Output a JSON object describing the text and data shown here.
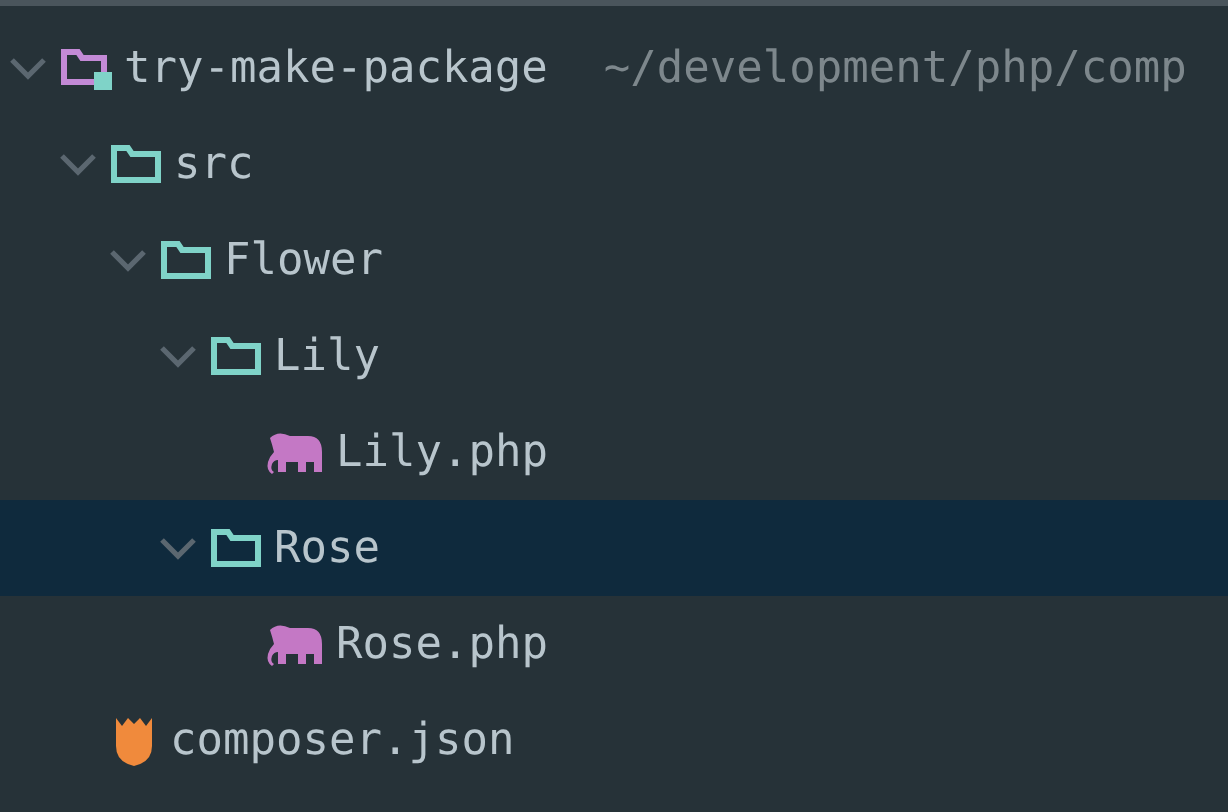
{
  "tree": [
    {
      "kind": "project",
      "label": "try-make-package",
      "path": "~/development/php/comp",
      "expanded": true,
      "selected": false,
      "children": [
        {
          "kind": "folder",
          "label": "src",
          "expanded": true,
          "selected": false,
          "children": [
            {
              "kind": "folder",
              "label": "Flower",
              "expanded": true,
              "selected": false,
              "children": [
                {
                  "kind": "folder",
                  "label": "Lily",
                  "expanded": true,
                  "selected": false,
                  "children": [
                    {
                      "kind": "php",
                      "label": "Lily.php",
                      "selected": false
                    }
                  ]
                },
                {
                  "kind": "folder",
                  "label": "Rose",
                  "expanded": true,
                  "selected": true,
                  "children": [
                    {
                      "kind": "php",
                      "label": "Rose.php",
                      "selected": false
                    }
                  ]
                }
              ]
            }
          ]
        },
        {
          "kind": "composer",
          "label": "composer.json",
          "selected": false
        }
      ]
    }
  ]
}
